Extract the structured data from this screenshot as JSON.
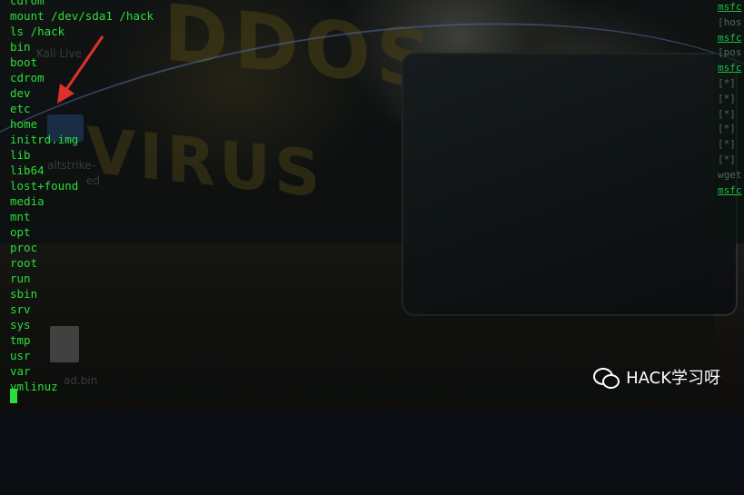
{
  "terminal": {
    "lines": [
      "cdrom",
      "mount /dev/sda1 /hack",
      "ls /hack",
      "bin",
      "boot",
      "cdrom",
      "dev",
      "etc",
      "home",
      "initrd.img",
      "lib",
      "lib64",
      "lost+found",
      "media",
      "mnt",
      "opt",
      "proc",
      "root",
      "run",
      "sbin",
      "srv",
      "sys",
      "tmp",
      "usr",
      "var",
      "vmlinuz"
    ],
    "text_color": "#2bdd3a"
  },
  "desktop": {
    "icon_label_1": "Kali Live",
    "icon_label_2": "altstrike-",
    "icon_label_3": "ed",
    "file_label": "ad.bin"
  },
  "wallpaper": {
    "word_1": "DDOS",
    "word_2": "VIRUS"
  },
  "background_terminal": {
    "rows": [
      "msfc",
      "[hos",
      "msfc",
      "[pos",
      "msfc",
      "[*]",
      "",
      "[*]",
      "[*]",
      "[*]",
      "[*]",
      "[*]",
      "wget",
      "msfc"
    ]
  },
  "watermark": {
    "icon": "wechat-icon",
    "text": "HACK学习呀"
  }
}
